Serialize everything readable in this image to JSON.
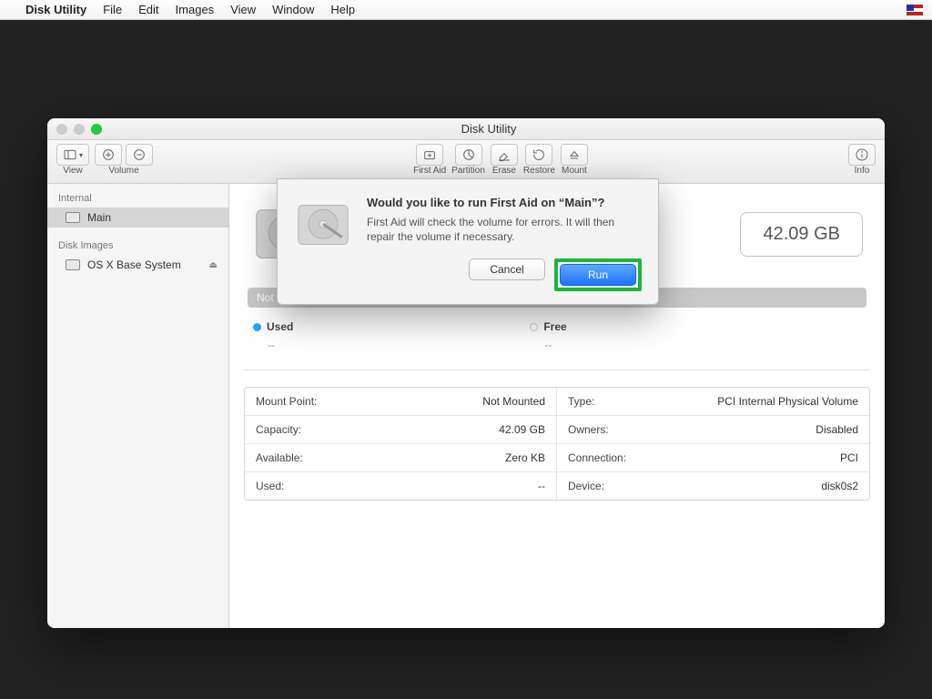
{
  "menubar": {
    "app": "Disk Utility",
    "items": [
      "File",
      "Edit",
      "Images",
      "View",
      "Window",
      "Help"
    ]
  },
  "window": {
    "title": "Disk Utility"
  },
  "toolbar": {
    "view": "View",
    "volume": "Volume",
    "first_aid": "First Aid",
    "partition": "Partition",
    "erase": "Erase",
    "restore": "Restore",
    "mount": "Mount",
    "info": "Info"
  },
  "sidebar": {
    "section_internal": "Internal",
    "item_main": "Main",
    "section_images": "Disk Images",
    "item_base": "OS X Base System"
  },
  "volume": {
    "size": "42.09 GB",
    "status": "Not Mounted",
    "used_label": "Used",
    "used_value": "--",
    "free_label": "Free",
    "free_value": "--"
  },
  "info": {
    "mount_point_k": "Mount Point:",
    "mount_point_v": "Not Mounted",
    "type_k": "Type:",
    "type_v": "PCI Internal Physical Volume",
    "capacity_k": "Capacity:",
    "capacity_v": "42.09 GB",
    "owners_k": "Owners:",
    "owners_v": "Disabled",
    "available_k": "Available:",
    "available_v": "Zero KB",
    "connection_k": "Connection:",
    "connection_v": "PCI",
    "used_k": "Used:",
    "used_v": "--",
    "device_k": "Device:",
    "device_v": "disk0s2"
  },
  "modal": {
    "title": "Would you like to run First Aid on “Main”?",
    "desc": "First Aid will check the volume for errors. It will then repair the volume if necessary.",
    "cancel": "Cancel",
    "run": "Run"
  }
}
